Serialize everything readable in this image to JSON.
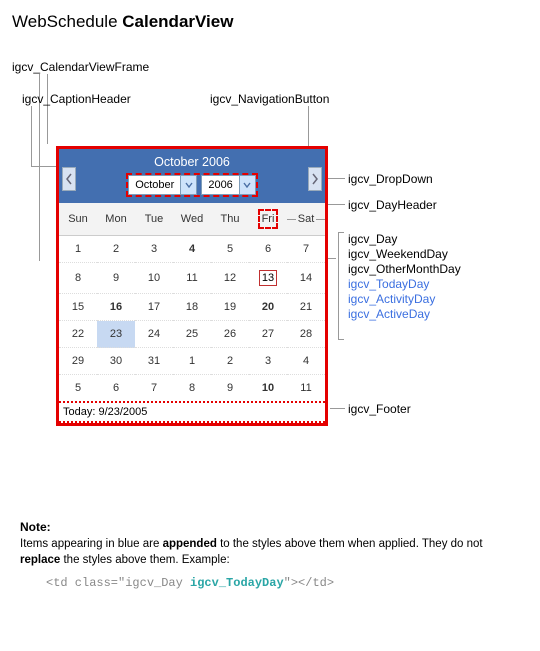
{
  "title_prefix": "WebSchedule ",
  "title_bold": "CalendarView",
  "callouts": {
    "frame": "igcv_CalendarViewFrame",
    "caption": "igcv_CaptionHeader",
    "nav": "igcv_NavigationButton",
    "dropdown": "igcv_DropDown",
    "dayheader": "igcv_DayHeader",
    "day": "igcv_Day",
    "weekend": "igcv_WeekendDay",
    "othermonth": "igcv_OtherMonthDay",
    "today": "igcv_TodayDay",
    "activity": "igcv_ActivityDay",
    "active": "igcv_ActiveDay",
    "footer": "igcv_Footer"
  },
  "caption_title": "October 2006",
  "dd_month": "October",
  "dd_year": "2006",
  "days": [
    "Sun",
    "Mon",
    "Tue",
    "Wed",
    "Thu",
    "Fri",
    "Sat"
  ],
  "weeks": [
    [
      {
        "v": "1"
      },
      {
        "v": "2"
      },
      {
        "v": "3"
      },
      {
        "v": "4",
        "b": true
      },
      {
        "v": "5"
      },
      {
        "v": "6"
      },
      {
        "v": "7"
      }
    ],
    [
      {
        "v": "8"
      },
      {
        "v": "9"
      },
      {
        "v": "10"
      },
      {
        "v": "11"
      },
      {
        "v": "12"
      },
      {
        "v": "13",
        "t": true
      },
      {
        "v": "14"
      }
    ],
    [
      {
        "v": "15"
      },
      {
        "v": "16",
        "b": true
      },
      {
        "v": "17"
      },
      {
        "v": "18"
      },
      {
        "v": "19"
      },
      {
        "v": "20",
        "b": true
      },
      {
        "v": "21"
      }
    ],
    [
      {
        "v": "22"
      },
      {
        "v": "23",
        "a": true
      },
      {
        "v": "24"
      },
      {
        "v": "25"
      },
      {
        "v": "26"
      },
      {
        "v": "27"
      },
      {
        "v": "28"
      }
    ],
    [
      {
        "v": "29"
      },
      {
        "v": "30"
      },
      {
        "v": "31"
      },
      {
        "v": "1",
        "o": true
      },
      {
        "v": "2",
        "o": true
      },
      {
        "v": "3",
        "o": true
      },
      {
        "v": "4",
        "o": true
      }
    ],
    [
      {
        "v": "5",
        "o": true
      },
      {
        "v": "6",
        "o": true
      },
      {
        "v": "7",
        "o": true
      },
      {
        "v": "8",
        "o": true
      },
      {
        "v": "9",
        "o": true
      },
      {
        "v": "10",
        "o": true,
        "b": true
      },
      {
        "v": "11",
        "o": true
      }
    ]
  ],
  "footer_text": "Today: 9/23/2005",
  "note_title": "Note:",
  "note_body_1": "Items appearing in blue are ",
  "note_body_b1": "appended",
  "note_body_2": " to the styles above them when applied. They do not ",
  "note_body_b2": "replace",
  "note_body_3": " the styles above them. Example:",
  "code_1": "<td class=\"igcv_Day ",
  "code_teal": "igcv_TodayDay",
  "code_2": "\"></td>"
}
